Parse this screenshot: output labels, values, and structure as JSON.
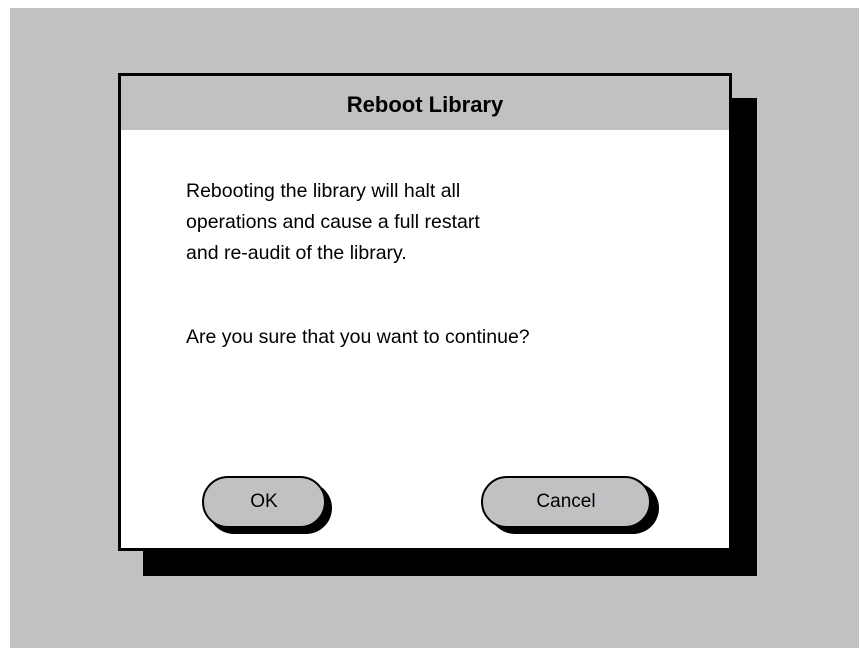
{
  "colors": {
    "desktop_background": "#c3c0c4",
    "dialog_background": "#ffffff",
    "title_bar": "#c3c0c4",
    "button_face": "#c3c0c4",
    "border_and_shadow": "#000000"
  },
  "dialog": {
    "title": "Reboot Library",
    "message_lines": [
      "Rebooting the library will halt all",
      "operations and cause a full restart",
      "and re-audit of the library."
    ],
    "question": "Are you sure that you want to continue?"
  },
  "buttons": {
    "ok_label": "OK",
    "cancel_label": "Cancel"
  }
}
